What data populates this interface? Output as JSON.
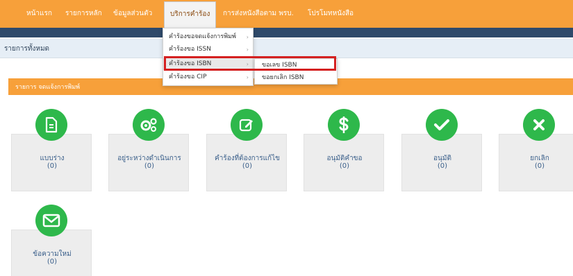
{
  "nav": {
    "items": [
      "หน้าแรก",
      "รายการหลัก",
      "ข้อมูลส่วนตัว",
      "บริการคำร้อง",
      "การส่งหนังสือตาม พรบ.",
      "โปรโมทหนังสือ"
    ]
  },
  "breadcrumb": "รายการทั้งหมด",
  "section": {
    "title": "รายการ จดแจ้งการพิมพ์"
  },
  "dropdown": {
    "items": [
      "คำร้องขอจดแจ้งการพิมพ์",
      "คำร้องขอ ISSN",
      "คำร้องขอ ISBN",
      "คำร้องขอ CIP"
    ],
    "arrow": "›"
  },
  "submenu": {
    "items": [
      "ขอเลข ISBN",
      "ขอยกเลิก ISBN"
    ]
  },
  "cards": [
    {
      "label": "แบบร่าง",
      "count": "(0)",
      "icon": "document-icon"
    },
    {
      "label": "อยู่ระหว่างดำเนินการ",
      "count": "(0)",
      "icon": "gears-icon"
    },
    {
      "label": "คำร้องที่ต้องการแก้ไข",
      "count": "(0)",
      "icon": "edit-icon"
    },
    {
      "label": "อนุมัติคำขอ",
      "count": "(0)",
      "icon": "dollar-icon"
    },
    {
      "label": "อนุมัติ",
      "count": "(0)",
      "icon": "check-icon"
    },
    {
      "label": "ยกเลิก",
      "count": "(0)",
      "icon": "close-icon"
    },
    {
      "label": "ข้อความใหม่",
      "count": "(0)",
      "icon": "envelope-icon"
    }
  ],
  "colors": {
    "accent": "#f7a03a",
    "icon_circle": "#2eb84b",
    "highlight": "#d42020",
    "header_bar": "#2f4a6b"
  }
}
